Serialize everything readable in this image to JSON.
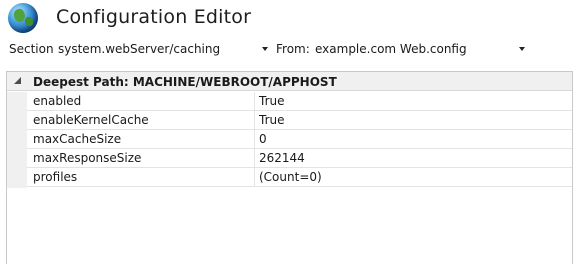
{
  "header": {
    "title": "Configuration Editor",
    "icon": "globe-icon"
  },
  "toolbar": {
    "section_label": "Section:",
    "section_value": "system.webServer/caching",
    "from_label": "From:",
    "from_value": "example.com Web.config"
  },
  "grid": {
    "group_title": "Deepest Path: MACHINE/WEBROOT/APPHOST",
    "rows": [
      {
        "name": "enabled",
        "value": "True"
      },
      {
        "name": "enableKernelCache",
        "value": "True"
      },
      {
        "name": "maxCacheSize",
        "value": "0"
      },
      {
        "name": "maxResponseSize",
        "value": "262144"
      },
      {
        "name": "profiles",
        "value": "(Count=0)"
      }
    ]
  },
  "colors": {
    "grid_border": "#c9c9c9",
    "header_bg": "#f0f0f0",
    "row_divider": "#e3e3e3"
  }
}
